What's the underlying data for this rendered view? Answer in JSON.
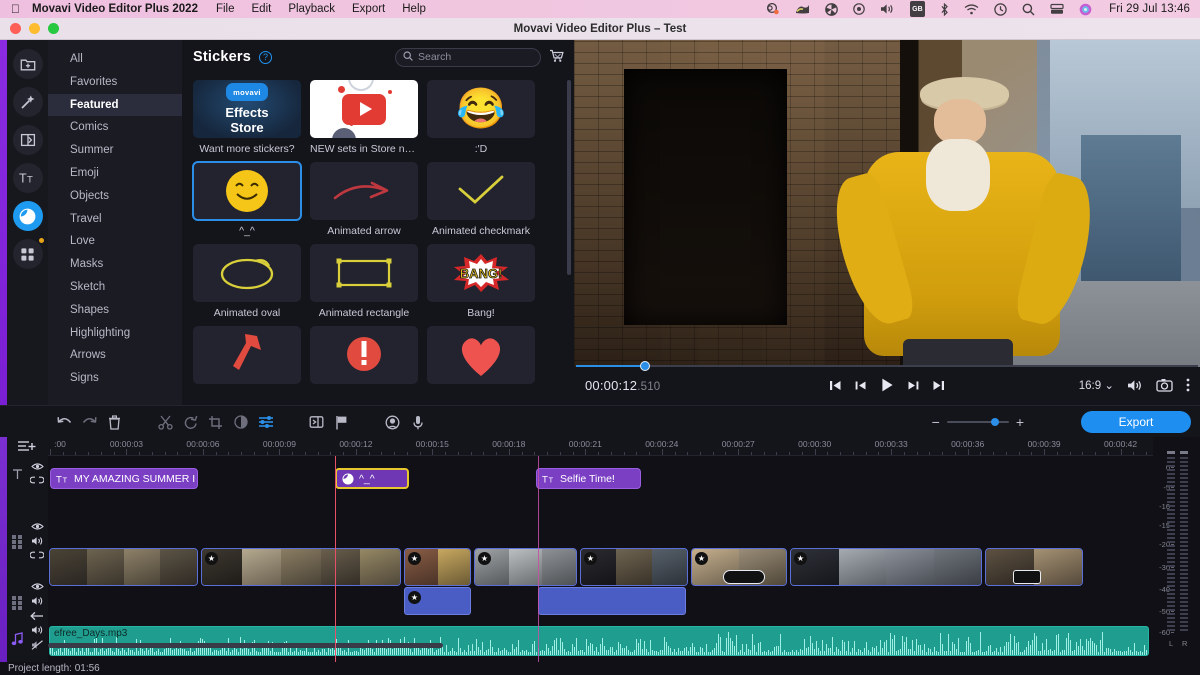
{
  "macbar": {
    "apple": "",
    "app_name": "Movavi Video Editor Plus 2022",
    "menus": [
      "File",
      "Edit",
      "Playback",
      "Export",
      "Help"
    ],
    "sys_icons": [
      "dropbox-icon",
      "mail-icon",
      "fan-icon",
      "record-icon",
      "volume-icon",
      "input-source-gb",
      "bluetooth-icon",
      "wifi-icon",
      "timemachine-icon",
      "search-icon",
      "display-icon",
      "siri-icon"
    ],
    "input_source": "GB",
    "clock": "Fri 29 Jul  13:46"
  },
  "window": {
    "title": "Movavi Video Editor Plus – Test",
    "traffic_lights": [
      "close",
      "minimize",
      "zoom"
    ]
  },
  "rail": {
    "items": [
      {
        "name": "import-tab",
        "icon": "folder-plus-icon",
        "active": false
      },
      {
        "name": "filters-tab",
        "icon": "magic-wand-icon",
        "active": false
      },
      {
        "name": "transitions-tab",
        "icon": "transition-icon",
        "active": false
      },
      {
        "name": "titles-tab",
        "icon": "text-tt-icon",
        "active": false
      },
      {
        "name": "stickers-tab",
        "icon": "sticker-icon",
        "active": true
      },
      {
        "name": "more-tab",
        "icon": "grid-icon",
        "active": false,
        "badge": true
      }
    ]
  },
  "categories": {
    "items": [
      {
        "label": "All",
        "selected": false
      },
      {
        "label": "Favorites",
        "selected": false
      },
      {
        "label": "Featured",
        "selected": true
      },
      {
        "label": "Comics",
        "selected": false
      },
      {
        "label": "Summer",
        "selected": false
      },
      {
        "label": "Emoji",
        "selected": false
      },
      {
        "label": "Objects",
        "selected": false
      },
      {
        "label": "Travel",
        "selected": false
      },
      {
        "label": "Love",
        "selected": false
      },
      {
        "label": "Masks",
        "selected": false
      },
      {
        "label": "Sketch",
        "selected": false
      },
      {
        "label": "Shapes",
        "selected": false
      },
      {
        "label": "Highlighting",
        "selected": false
      },
      {
        "label": "Arrows",
        "selected": false
      },
      {
        "label": "Signs",
        "selected": false
      }
    ]
  },
  "stickers_panel": {
    "title": "Stickers",
    "help_glyph": "?",
    "search_placeholder": "Search",
    "search_value": "",
    "clear_glyph": "✕",
    "cart_icon": "cart-icon",
    "items": [
      {
        "label": "Want more stickers?",
        "kind": "effects-store",
        "store_badge": "movavi",
        "store_line1": "Effects",
        "store_line2": "Store",
        "selected": false
      },
      {
        "label": "NEW sets in Store now!",
        "kind": "youtube",
        "selected": false
      },
      {
        "label": ":'D",
        "kind": "emoji",
        "glyph": "😂",
        "selected": false
      },
      {
        "label": "^_^",
        "kind": "smiley",
        "selected": true
      },
      {
        "label": "Animated arrow",
        "kind": "arrow",
        "selected": false
      },
      {
        "label": "Animated checkmark",
        "kind": "check",
        "selected": false
      },
      {
        "label": "Animated oval",
        "kind": "oval",
        "selected": false
      },
      {
        "label": "Animated rectangle",
        "kind": "rect",
        "selected": false
      },
      {
        "label": "Bang!",
        "kind": "bang",
        "bang_text": "BANG!",
        "selected": false
      },
      {
        "label": "",
        "kind": "red-arrow",
        "selected": false
      },
      {
        "label": "",
        "kind": "red-exclaim",
        "selected": false
      },
      {
        "label": "",
        "kind": "red-heart",
        "selected": false
      }
    ]
  },
  "preview": {
    "current_time": "00:00:12",
    "current_time_ms": ".510",
    "aspect_ratio": "16:9",
    "seek_percent": 11,
    "controls": [
      {
        "name": "jump-start-button",
        "glyph": "start"
      },
      {
        "name": "prev-frame-button",
        "glyph": "prev"
      },
      {
        "name": "play-button",
        "glyph": "play"
      },
      {
        "name": "next-frame-button",
        "glyph": "next"
      },
      {
        "name": "jump-end-button",
        "glyph": "end"
      }
    ],
    "right_controls": [
      "volume-icon",
      "snapshot-icon",
      "more-options-icon"
    ],
    "overlay_sticker": "smiley-face"
  },
  "toolbar": {
    "buttons": [
      {
        "name": "undo-button",
        "icon": "undo-icon",
        "state": "enabled"
      },
      {
        "name": "redo-button",
        "icon": "redo-icon",
        "state": "disabled"
      },
      {
        "name": "delete-button",
        "icon": "trash-icon",
        "state": "enabled"
      },
      {
        "name": "split-button",
        "icon": "scissors-icon",
        "state": "disabled"
      },
      {
        "name": "rotate-button",
        "icon": "rotate-icon",
        "state": "disabled"
      },
      {
        "name": "crop-button",
        "icon": "crop-icon",
        "state": "disabled"
      },
      {
        "name": "color-adjust-button",
        "icon": "contrast-icon",
        "state": "disabled"
      },
      {
        "name": "properties-button",
        "icon": "sliders-icon",
        "state": "active"
      },
      {
        "name": "clip-button",
        "icon": "clip-icon",
        "state": "enabled"
      },
      {
        "name": "marker-button",
        "icon": "flag-icon",
        "state": "enabled"
      },
      {
        "name": "record-video-button",
        "icon": "webcam-icon",
        "state": "enabled"
      },
      {
        "name": "record-audio-button",
        "icon": "microphone-icon",
        "state": "enabled"
      }
    ],
    "zoom_out_glyph": "−",
    "zoom_in_glyph": "+",
    "zoom_percent": 71,
    "export_label": "Export"
  },
  "timeline": {
    "ruler_labels": [
      ":00",
      "00:00:03",
      "00:00:06",
      "00:00:09",
      "00:00:12",
      "00:00:15",
      "00:00:18",
      "00:00:21",
      "00:00:24",
      "00:00:27",
      "00:00:30",
      "00:00:33",
      "00:00:36",
      "00:00:39",
      "00:00:42"
    ],
    "playhead_time": "00:00:12",
    "title_clips": [
      {
        "label": "MY AMAZING SUMMER I",
        "icon": "text-tt-icon",
        "selected": false
      },
      {
        "label": "^_^",
        "icon": "sticker-icon",
        "selected": true
      },
      {
        "label": "Selfie Time!",
        "icon": "text-tt-icon",
        "selected": false
      }
    ],
    "track_headers": [
      {
        "name": "add-track-button",
        "icons": [
          "add-track-icon"
        ]
      },
      {
        "name": "titles-track-header",
        "icons": [
          "text-tt-icon",
          "eye-icon",
          "link-icon"
        ]
      },
      {
        "name": "overlay-track-header",
        "icons": [
          "clips-icon",
          "eye-icon",
          "speaker-icon",
          "link-icon"
        ]
      },
      {
        "name": "video-track-header",
        "icons": [
          "clips-icon",
          "eye-icon",
          "speaker-icon",
          "arrow-left-icon"
        ]
      },
      {
        "name": "audio-track-header",
        "icons": [
          "music-note-icon",
          "speaker-icon",
          "speaker-muted-icon"
        ]
      }
    ],
    "audio_clip": {
      "name": "efree_Days.mp3"
    }
  },
  "meter": {
    "scale": [
      "0",
      "-5",
      "-10",
      "-15",
      "-20",
      "-30",
      "-40",
      "-50",
      "-60"
    ],
    "channels": [
      "L",
      "R"
    ]
  },
  "status": {
    "project_length_label": "Project length: 01:56"
  },
  "colors": {
    "accent": "#1e8ef0",
    "title_clip": "#7b3fc4",
    "selected_clip_border": "#e8c62e",
    "audio_clip": "#1f9d8f",
    "playhead": "#e8506a",
    "menubar": "#efbfe0"
  }
}
